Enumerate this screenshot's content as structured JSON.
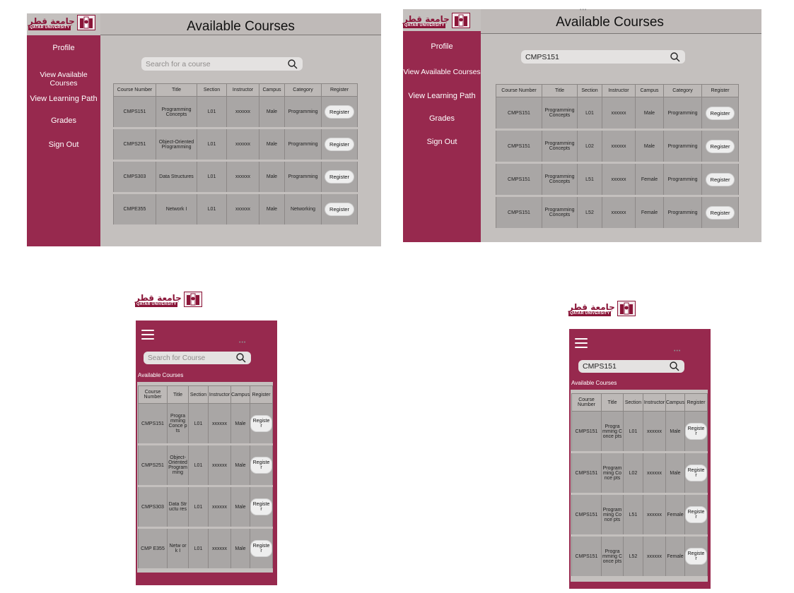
{
  "brand": {
    "arabic": "جامعة قطر",
    "english": "QATAR UNIVERSITY",
    "color": "#8a1538"
  },
  "theme": {
    "sidebar": "#97294e",
    "panel": "#c4c0be",
    "row": "#a9a6a5"
  },
  "nav": {
    "items": [
      {
        "label": "Profile"
      },
      {
        "label": "View Available Courses"
      },
      {
        "label": "View Learning Path"
      },
      {
        "label": "Grades"
      },
      {
        "label": "Sign Out"
      }
    ]
  },
  "desktop_a": {
    "title": "Available Courses",
    "search": {
      "placeholder": "Search for a course",
      "value": ""
    },
    "headers": [
      "Course Number",
      "Title",
      "Section",
      "Instructor",
      "Campus",
      "Category",
      "Register"
    ],
    "rows": [
      [
        "CMPS151",
        "Programming Concepts",
        "L01",
        "xxxxxx",
        "Male",
        "Programming",
        "Register"
      ],
      [
        "CMPS251",
        "Object-Oriented Programming",
        "L01",
        "xxxxxx",
        "Male",
        "Programming",
        "Register"
      ],
      [
        "CMPS303",
        "Data Structures",
        "L01",
        "xxxxxx",
        "Male",
        "Programming",
        "Register"
      ],
      [
        "CMPE355",
        "Network I",
        "L01",
        "xxxxxx",
        "Male",
        "Networking",
        "Register"
      ]
    ]
  },
  "desktop_b": {
    "title": "Available Courses",
    "search": {
      "value": "CMPS151"
    },
    "headers": [
      "Course Number",
      "Title",
      "Section",
      "Instructor",
      "Campus",
      "Category",
      "Register"
    ],
    "rows": [
      [
        "CMPS151",
        "Programming Concepts",
        "L01",
        "xxxxxx",
        "Male",
        "Programming",
        "Register"
      ],
      [
        "CMPS151",
        "Programming Concepts",
        "L02",
        "xxxxxx",
        "Male",
        "Programming",
        "Register"
      ],
      [
        "CMPS151",
        "Programming Concepts",
        "L51",
        "xxxxxx",
        "Female",
        "Programming",
        "Register"
      ],
      [
        "CMPS151",
        "Programming Concepts",
        "L52",
        "xxxxxx",
        "Female",
        "Programming",
        "Register"
      ]
    ]
  },
  "mobile_a": {
    "label": "Available Courses",
    "search": {
      "placeholder": "Search for Course",
      "value": ""
    },
    "headers": [
      "Course Number",
      "Title",
      "Section",
      "Instructor",
      "Campus",
      "Register"
    ],
    "rows": [
      [
        "CMPS151",
        "Progra mming Conce pts",
        "L01",
        "xxxxxx",
        "Male",
        "Register"
      ],
      [
        "CMPS251",
        "Object- Oriented Program ming",
        "L01",
        "xxxxxx",
        "Male",
        "Register"
      ],
      [
        "CMPS303",
        "Data Structu res",
        "L01",
        "xxxxxx",
        "Male",
        "Register"
      ],
      [
        "CMP E355",
        "Netw ork I",
        "L01",
        "xxxxxx",
        "Male",
        "Register"
      ]
    ]
  },
  "mobile_b": {
    "label": "Available Courses",
    "search": {
      "value": "CMPS151"
    },
    "headers": [
      "Course Number",
      "Title",
      "Section",
      "Instructor",
      "Campus",
      "Register"
    ],
    "rows": [
      [
        "CMPS151",
        "Progra mming Conce pts",
        "L01",
        "xxxxxx",
        "Male",
        "Register"
      ],
      [
        "CMPS151",
        "Program ming Conce pts",
        "L02",
        "xxxxxx",
        "Male",
        "Register"
      ],
      [
        "CMPS151",
        "Program ming Conce pts",
        "L51",
        "xxxxxx",
        "Female",
        "Register"
      ],
      [
        "CMPS151",
        "Progra mming Conce pts",
        "L52",
        "xxxxxx",
        "Female",
        "Register"
      ]
    ]
  }
}
